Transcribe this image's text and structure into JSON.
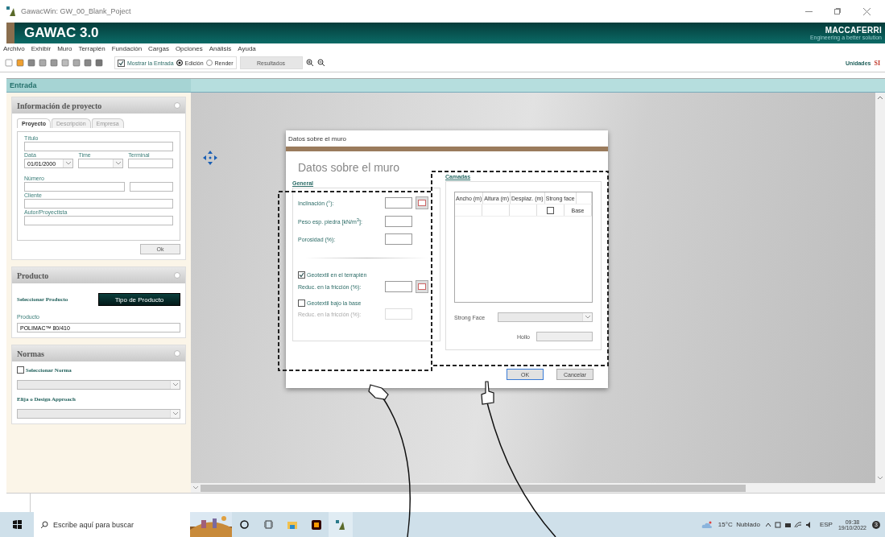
{
  "window": {
    "title": "GawacWin: GW_00_Blank_Poject"
  },
  "banner": {
    "title": "GAWAC 3.0",
    "brand": "MACCAFERRI",
    "tagline": "Engineering a better solution"
  },
  "menu": [
    "Archivo",
    "Exhibir",
    "Muro",
    "Terraplén",
    "Fundación",
    "Cargas",
    "Opciones",
    "Análisis",
    "Ayuda"
  ],
  "toolbar": {
    "show_input": {
      "label": "Mostrar la Entrada",
      "checked": true
    },
    "modes": [
      {
        "label": "Edición",
        "selected": true
      },
      {
        "label": "Render",
        "selected": false
      }
    ],
    "results_button": "Resultados",
    "units_label": "Unidades",
    "units_value": "SI"
  },
  "entrada_header": "Entrada",
  "project_panel": {
    "title": "Información de proyecto",
    "tabs": [
      {
        "label": "Proyecto",
        "selected": true
      },
      {
        "label": "Descripción",
        "selected": false
      },
      {
        "label": "Empresa",
        "selected": false
      }
    ],
    "titulo_label": "Título",
    "date_label": "Data",
    "date_value": "01/01/2000",
    "time_label": "Time",
    "terminal_label": "Terminal",
    "numero_label": "Número",
    "cliente_label": "Cliente",
    "autor_label": "Autor/Proyectista",
    "ok_button": "Ok"
  },
  "product_panel": {
    "title": "Producto",
    "select_label": "Seleccionar Producto",
    "type_button": "Tipo de Producto",
    "product_label": "Producto",
    "product_value": "POLIMAC™ 80/410"
  },
  "norms_panel": {
    "title": "Normas",
    "select_norm": {
      "label": "Seleccionar Norma",
      "checked": false
    },
    "approach_label": "Elija o Design Approach"
  },
  "dialog": {
    "title": "Datos sobre el muro",
    "heading": "Datos sobre el muro",
    "general": {
      "title": "General",
      "fields": [
        {
          "label": "Inclinación (°):",
          "button": true
        },
        {
          "label": "Peso esp. piedra [kN/m$^{3}$]:",
          "button": false
        },
        {
          "label": "Porosidad (%):",
          "button": false
        }
      ],
      "geotextiles": [
        {
          "label": "Geotextil en el terraplén",
          "checked": true,
          "field_label": "Reduc. en la fricción (%):",
          "disabled": false,
          "button": true
        },
        {
          "label": "Geotextil bajo la base",
          "checked": false,
          "field_label": "Reduc. en la fricción (%):",
          "disabled": true,
          "button": false
        }
      ]
    },
    "layers": {
      "title": "Camadas",
      "columns": [
        "Ancho (m)",
        "Altura (m)",
        "Desplaz. (m)",
        "Strong face"
      ],
      "rows": [
        {
          "strong_face": false,
          "label": "Base"
        }
      ],
      "strong_face_label": "Strong Face",
      "hollow_label": "Hollo"
    },
    "buttons": [
      {
        "label": "OK",
        "selected": true
      },
      {
        "label": "Cancelar",
        "selected": false
      }
    ]
  },
  "taskbar": {
    "search_placeholder": "Escribe aquí para buscar",
    "weather": "15°C  Nublado",
    "language": "ESP",
    "time": "09:38",
    "date": "19/10/2022",
    "notifications": "3"
  }
}
